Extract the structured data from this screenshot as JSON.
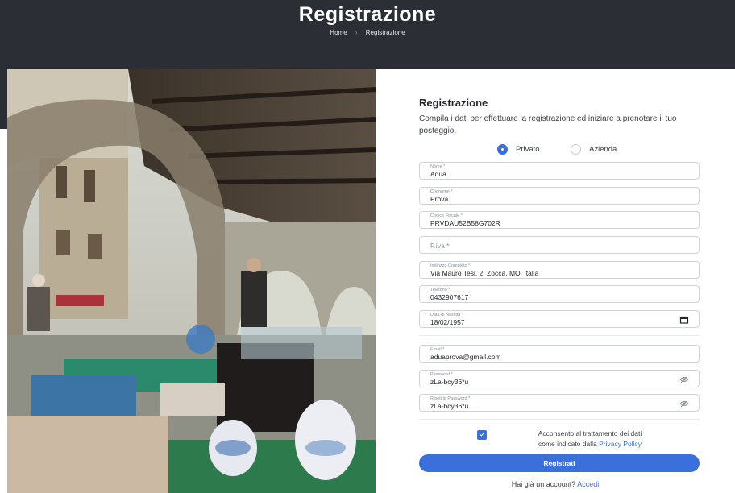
{
  "colors": {
    "header_bg": "#2b2f35",
    "accent": "#3a6fdc",
    "breadcrumb_sep": "#c98a6b"
  },
  "header": {
    "title": "Registrazione",
    "breadcrumb": {
      "home": "Home",
      "separator": "›",
      "current": "Registrazione"
    }
  },
  "photo": {
    "description_icon": "market-arcade-photo"
  },
  "form": {
    "title": "Registrazione",
    "intro": "Compila i dati per effettuare la registrazione ed iniziare a prenotare il tuo posteggio.",
    "type": {
      "options": [
        "Privato",
        "Azienda"
      ],
      "selected": "Privato"
    },
    "fields": {
      "nome": {
        "label": "Nome *",
        "value": "Adua"
      },
      "cognome": {
        "label": "Cognome *",
        "value": "Prova"
      },
      "codice_fiscale": {
        "label": "Codice Fiscale *",
        "value": "PRVDAU52B58G702R"
      },
      "piva": {
        "placeholder": "P.iva *"
      },
      "indirizzo": {
        "label": "Indirizzo Completo *",
        "value": "Via Mauro Tesi, 2, Zocca, MO, Italia"
      },
      "telefono": {
        "label": "Telefono *",
        "value": "0432907617"
      },
      "data_nascita": {
        "label": "Data di Nascita *",
        "value": "18/02/1957",
        "icon": "calendar-icon"
      },
      "email": {
        "label": "Email *",
        "value": "aduaprova@gmail.com"
      },
      "password": {
        "label": "Password *",
        "value": "zLa-bcy36*u",
        "icon": "eye-slash-icon"
      },
      "password_repeat": {
        "label": "Ripeti la Password *",
        "value": "zLa-bcy36*u",
        "icon": "eye-slash-icon"
      }
    },
    "consent": {
      "checked": true,
      "text_line1": "Acconsento al trattamento dei dati",
      "text_line2": "come indicato dalla",
      "link": "Privacy Policy"
    },
    "submit_label": "Registrati",
    "login_prompt": "Hai già un account?",
    "login_link": "Accedi"
  }
}
